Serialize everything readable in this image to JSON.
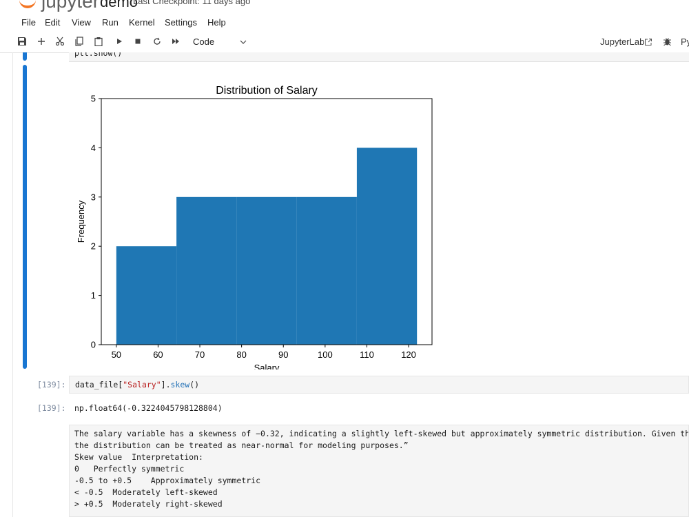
{
  "header": {
    "notebook_name": "demo",
    "checkpoint": "Last Checkpoint: 11 days ago"
  },
  "menu": {
    "items": [
      "File",
      "Edit",
      "View",
      "Run",
      "Kernel",
      "Settings",
      "Help"
    ]
  },
  "toolbar": {
    "icons": [
      "save-icon",
      "add-cell-icon",
      "cut-icon",
      "copy-icon",
      "paste-icon",
      "run-icon",
      "stop-icon",
      "restart-icon",
      "run-all-icon"
    ],
    "cell_type": "Code",
    "jupyterlab_link": "JupyterLab",
    "kernel_label": "Py"
  },
  "cells": {
    "prev_code": "plt.show()",
    "skew_prompt": "[139]:",
    "skew_code_prefix": "data_file[",
    "skew_code_string": "\"Salary\"",
    "skew_code_mid": "].",
    "skew_code_fn": "skew",
    "skew_code_suffix": "()",
    "out_prompt": "[139]:",
    "output": "np.float64(-0.3224045798128804)",
    "markdown_lines": [
      "The salary variable has a skewness of −0.32, indicating a slightly left-skewed but approximately symmetric distribution. Given th",
      "the distribution can be treated as near-normal for modeling purposes.”",
      "Skew value  Interpretation:",
      "0   Perfectly symmetric",
      "-0.5 to +0.5    Approximately symmetric",
      "< -0.5  Moderately left-skewed",
      "> +0.5  Moderately right-skewed"
    ]
  },
  "chart_data": {
    "type": "bar",
    "title": "Distribution of Salary",
    "xlabel": "Salary",
    "ylabel": "Frequency",
    "bins": [
      {
        "start": 50,
        "end": 64.4,
        "count": 2
      },
      {
        "start": 64.4,
        "end": 78.8,
        "count": 3
      },
      {
        "start": 78.8,
        "end": 93.2,
        "count": 3
      },
      {
        "start": 93.2,
        "end": 107.6,
        "count": 3
      },
      {
        "start": 107.6,
        "end": 122,
        "count": 4
      }
    ],
    "xlim": [
      46.4,
      125.6
    ],
    "ylim": [
      0,
      5
    ],
    "xticks": [
      50,
      60,
      70,
      80,
      90,
      100,
      110,
      120
    ],
    "yticks": [
      0,
      1,
      2,
      3,
      4,
      5
    ],
    "bar_color": "#1f77b4",
    "grid": false
  }
}
